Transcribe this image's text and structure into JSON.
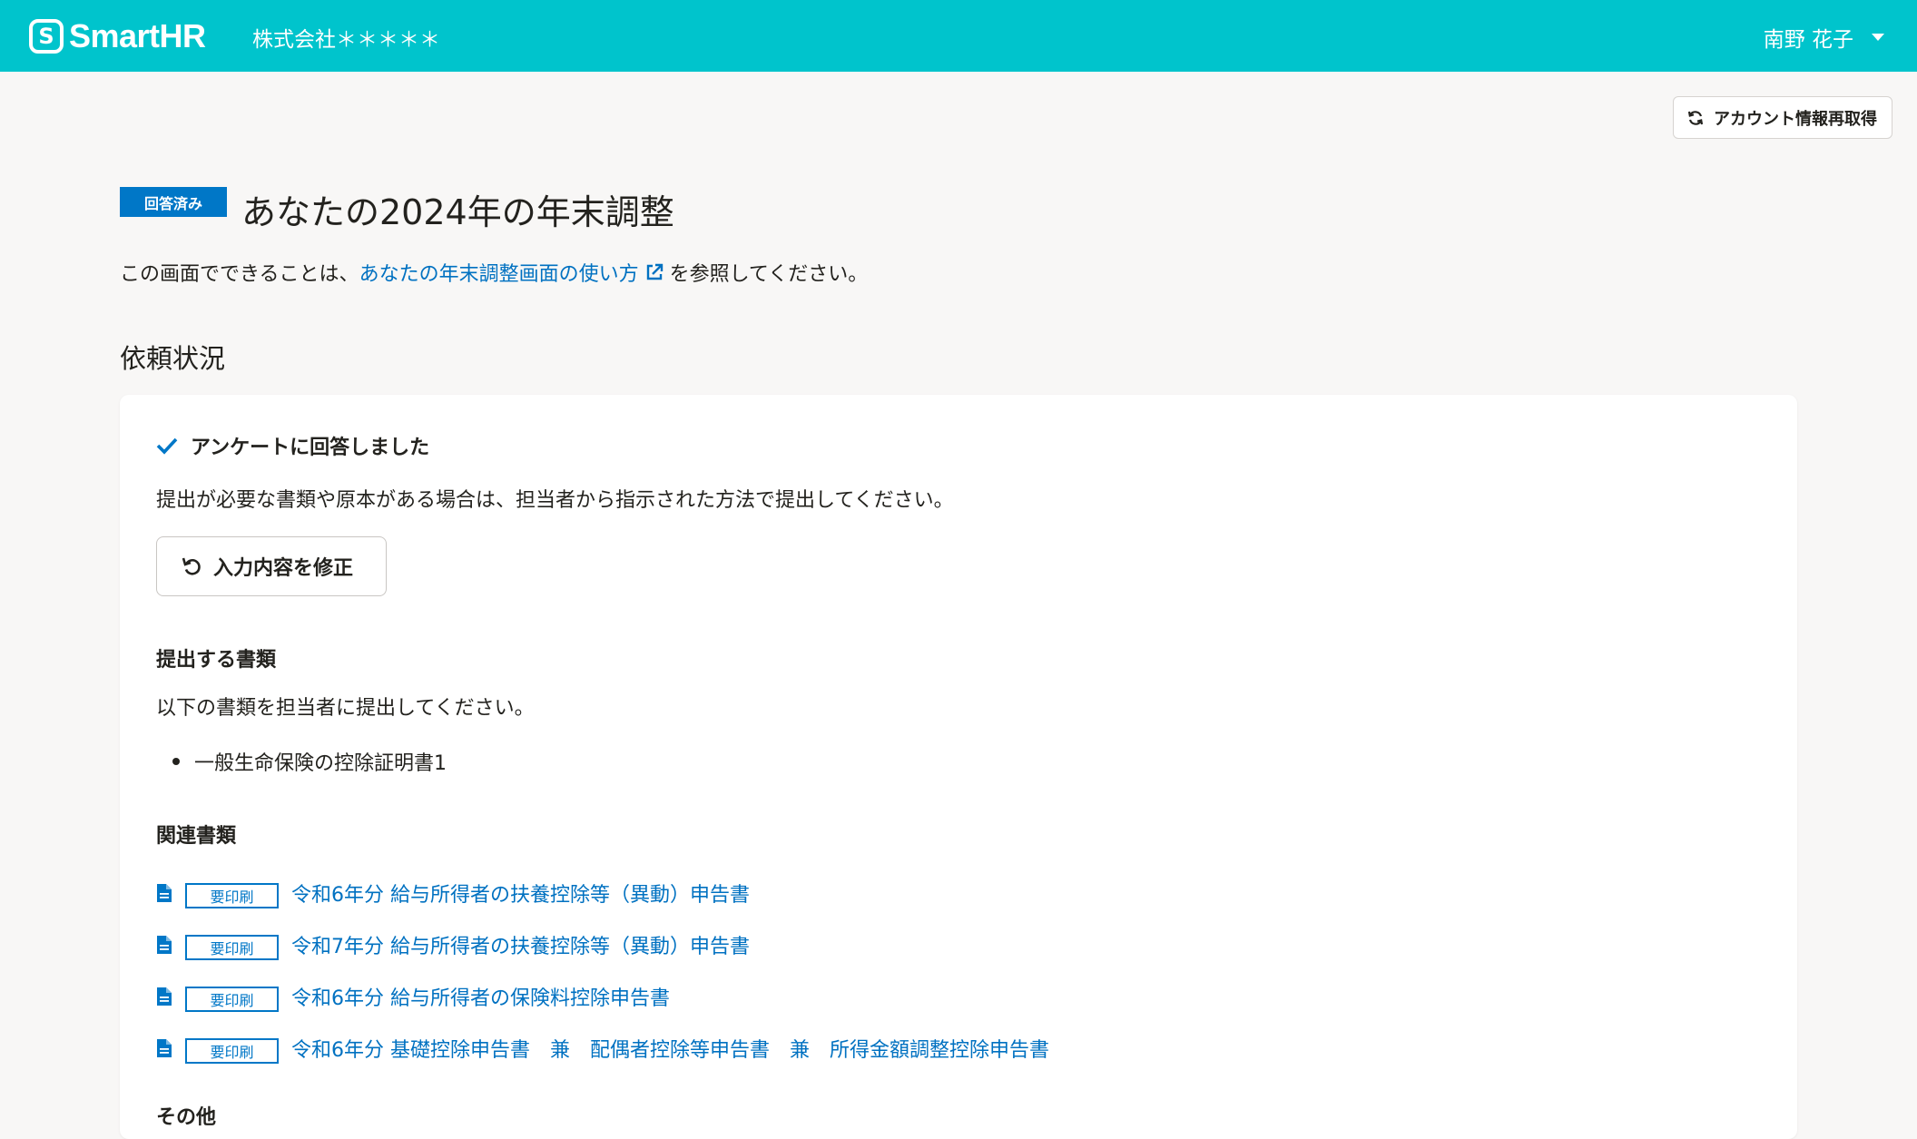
{
  "header": {
    "logo_mark": "S",
    "logo_text": "SmartHR",
    "company": "株式会社＊＊＊＊＊",
    "user_name": "南野 花子"
  },
  "toolbar": {
    "refresh_label": "アカウント情報再取得"
  },
  "page": {
    "status_badge": "回答済み",
    "title": "あなたの2024年の年末調整",
    "intro_before": "この画面でできることは、",
    "intro_link": "あなたの年末調整画面の使い方",
    "intro_after": "を参照してください。",
    "section_title": "依頼状況"
  },
  "card": {
    "check_label": "アンケートに回答しました",
    "description": "提出が必要な書類や原本がある場合は、担当者から指示された方法で提出してください。",
    "edit_label": "入力内容を修正",
    "submit_heading": "提出する書類",
    "submit_text": "以下の書類を担当者に提出してください。",
    "submit_docs": [
      "一般生命保険の控除証明書1"
    ],
    "related_heading": "関連書類",
    "related_docs": [
      {
        "badge": "要印刷",
        "label": "令和6年分 給与所得者の扶養控除等（異動）申告書"
      },
      {
        "badge": "要印刷",
        "label": "令和7年分 給与所得者の扶養控除等（異動）申告書"
      },
      {
        "badge": "要印刷",
        "label": "令和6年分 給与所得者の保険料控除申告書"
      },
      {
        "badge": "要印刷",
        "label": "令和6年分 基礎控除申告書　兼　配偶者控除等申告書　兼　所得金額調整控除申告書"
      }
    ],
    "other_heading": "その他"
  },
  "colors": {
    "header": "#00c4cc",
    "accent": "#0077c7",
    "link": "#0071c1",
    "background": "#f8f7f6"
  }
}
